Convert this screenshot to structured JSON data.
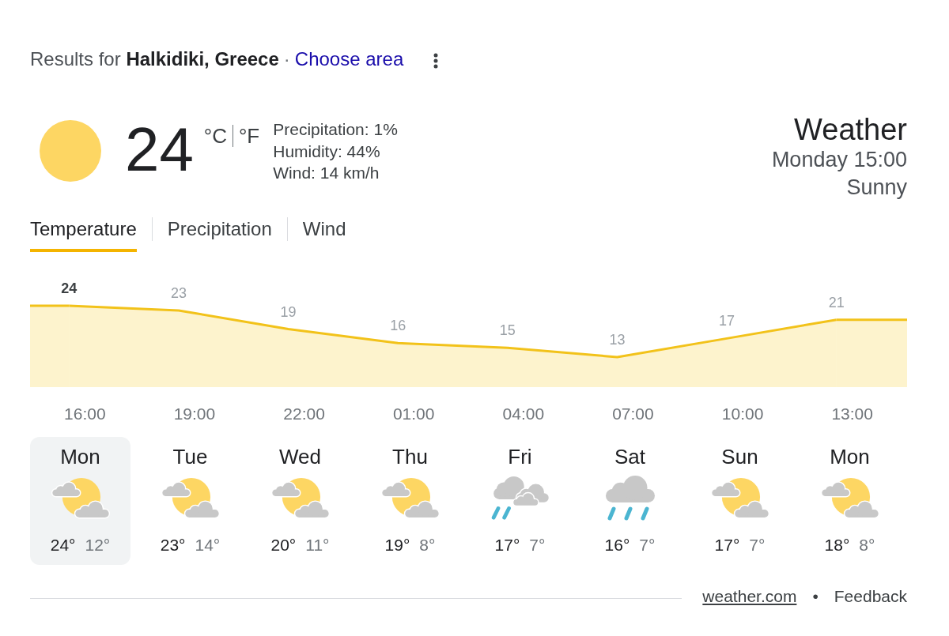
{
  "header": {
    "query": "Results for **Halkidiki, Greece**",
    "separator": "·",
    "change_location_link": "Choose area"
  },
  "current": {
    "temperature": "24",
    "units": [
      "°C",
      "°F"
    ],
    "details": [
      "Precipitation: 1%",
      "Humidity: 44%",
      "Wind: 14 km/h"
    ]
  },
  "summary": {
    "title": "Weather",
    "time": "Monday 15:00",
    "condition": "Sunny"
  },
  "tabs": [
    {
      "label": "Temperature",
      "selected": true
    },
    {
      "label": "Precipitation",
      "selected": false
    },
    {
      "label": "Wind",
      "selected": false
    }
  ],
  "chart": {
    "chart_data": {
      "type": "area",
      "categories": [
        "16:00",
        "19:00",
        "22:00",
        "01:00",
        "04:00",
        "07:00",
        "10:00",
        "13:00"
      ],
      "values": [
        24,
        23,
        19,
        16,
        15,
        13,
        17,
        21
      ],
      "data_labels": true
    }
  },
  "days": [
    {
      "day": "Mon",
      "kind": "partly",
      "high": "24°",
      "low": "12°",
      "selected": true
    },
    {
      "day": "Tue",
      "kind": "partly",
      "high": "23°",
      "low": "14°",
      "selected": false
    },
    {
      "day": "Wed",
      "kind": "partly",
      "high": "20°",
      "low": "11°",
      "selected": false
    },
    {
      "day": "Thu",
      "kind": "partly",
      "high": "19°",
      "low": "8°",
      "selected": false
    },
    {
      "day": "Fri",
      "kind": "showers",
      "high": "17°",
      "low": "7°",
      "selected": false
    },
    {
      "day": "Sat",
      "kind": "rain",
      "high": "16°",
      "low": "7°",
      "selected": false
    },
    {
      "day": "Sun",
      "kind": "partly",
      "high": "17°",
      "low": "7°",
      "selected": false
    },
    {
      "day": "Mon",
      "kind": "partly",
      "high": "18°",
      "low": "8°",
      "selected": false
    }
  ],
  "footer": {
    "source_link": "weather.com",
    "separator": "•",
    "feedback_link": "Feedback"
  }
}
